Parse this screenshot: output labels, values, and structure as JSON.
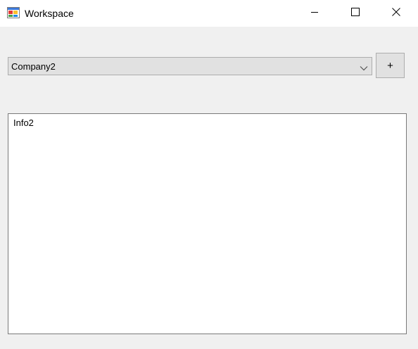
{
  "window": {
    "title": "Workspace",
    "app_icon": "form-app-icon",
    "controls": {
      "minimize_icon": "minimize-icon",
      "maximize_icon": "maximize-icon",
      "close_icon": "close-icon"
    }
  },
  "company_select": {
    "selected_value": "Company2",
    "dropdown_icon": "chevron-down-icon"
  },
  "add_button": {
    "label": "+"
  },
  "info_box": {
    "text": "Info2"
  },
  "colors": {
    "window_bg": "#f0f0f0",
    "titlebar_bg": "#ffffff",
    "control_bg": "#e1e1e1",
    "control_border": "#adadad",
    "textbox_border": "#7a7a7a"
  }
}
